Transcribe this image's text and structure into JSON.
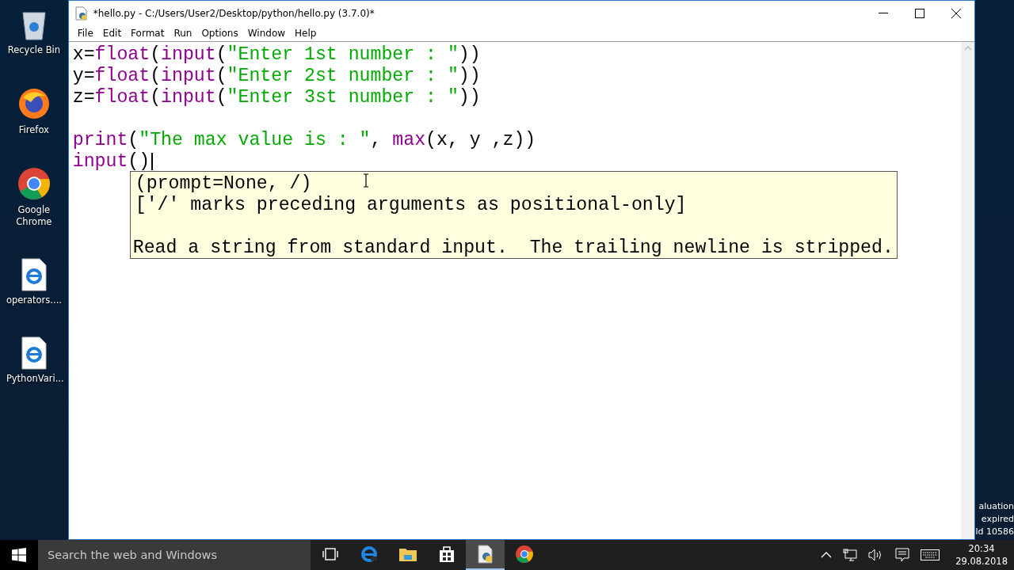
{
  "desktop_icons": [
    {
      "label": "Recycle Bin",
      "kind": "recycle"
    },
    {
      "label": "Firefox",
      "kind": "firefox"
    },
    {
      "label": "Google Chrome",
      "kind": "chrome"
    },
    {
      "label": "operators....",
      "kind": "edgefile"
    },
    {
      "label": "PythonVari...",
      "kind": "edgefile"
    }
  ],
  "window": {
    "title": "*hello.py - C:/Users/User2/Desktop/python/hello.py (3.7.0)*"
  },
  "menu": [
    "File",
    "Edit",
    "Format",
    "Run",
    "Options",
    "Window",
    "Help"
  ],
  "editor": {
    "blocks": [
      {
        "lines": [
          {
            "tokens": [
              {
                "text": "x=",
                "kind": "plain"
              },
              {
                "text": "float",
                "kind": "builtin"
              },
              {
                "text": "(",
                "kind": "plain"
              },
              {
                "text": "input",
                "kind": "builtin"
              },
              {
                "text": "(",
                "kind": "plain"
              },
              {
                "text": "\"Enter 1st number : \"",
                "kind": "string"
              },
              {
                "text": "))",
                "kind": "plain"
              }
            ]
          },
          {
            "tokens": [
              {
                "text": "y=",
                "kind": "plain"
              },
              {
                "text": "float",
                "kind": "builtin"
              },
              {
                "text": "(",
                "kind": "plain"
              },
              {
                "text": "input",
                "kind": "builtin"
              },
              {
                "text": "(",
                "kind": "plain"
              },
              {
                "text": "\"Enter 2st number : \"",
                "kind": "string"
              },
              {
                "text": "))",
                "kind": "plain"
              }
            ]
          },
          {
            "tokens": [
              {
                "text": "z=",
                "kind": "plain"
              },
              {
                "text": "float",
                "kind": "builtin"
              },
              {
                "text": "(",
                "kind": "plain"
              },
              {
                "text": "input",
                "kind": "builtin"
              },
              {
                "text": "(",
                "kind": "plain"
              },
              {
                "text": "\"Enter 3st number : \"",
                "kind": "string"
              },
              {
                "text": "))",
                "kind": "plain"
              }
            ]
          }
        ]
      },
      {
        "lines": [
          {
            "tokens": [
              {
                "text": "print",
                "kind": "builtin"
              },
              {
                "text": "(",
                "kind": "plain"
              },
              {
                "text": "\"The max value is : \"",
                "kind": "string"
              },
              {
                "text": ", ",
                "kind": "plain"
              },
              {
                "text": "max",
                "kind": "builtin"
              },
              {
                "text": "(x, y ,z))",
                "kind": "plain"
              }
            ]
          },
          {
            "tokens": [
              {
                "text": "input",
                "kind": "builtin"
              },
              {
                "text": "()",
                "kind": "plain"
              }
            ]
          }
        ]
      }
    ],
    "calltip": {
      "signature": "(prompt=None, /)",
      "note": "['/' marks preceding arguments as positional-only]",
      "doc": "Read a string from standard input.  The trailing newline is stripped."
    }
  },
  "watermark_lines": [
    "aluation",
    "expired",
    "ld 10586"
  ],
  "taskbar": {
    "search": {
      "placeholder": "Search the web and Windows"
    },
    "apps": [
      {
        "kind": "taskview",
        "active": false
      },
      {
        "kind": "edge",
        "active": false
      },
      {
        "kind": "folder",
        "active": false
      },
      {
        "kind": "store",
        "active": false
      },
      {
        "kind": "idle",
        "active": true
      },
      {
        "kind": "chrome",
        "active": false
      }
    ],
    "time": "20:34",
    "date": "29.08.2018"
  }
}
